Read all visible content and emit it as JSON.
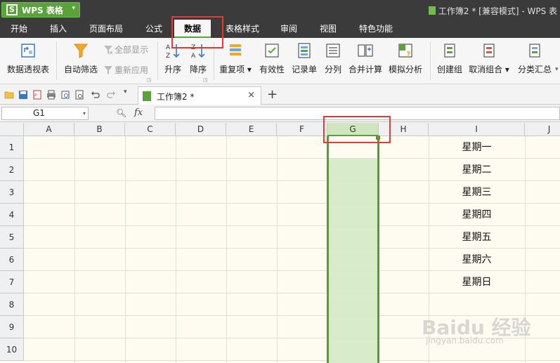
{
  "title_bar": {
    "app_name": "WPS 表格",
    "window_title": "工作簿2 * [兼容模式] - WPS 表"
  },
  "menu": {
    "tabs": [
      "开始",
      "插入",
      "页面布局",
      "公式",
      "数据",
      "表格样式",
      "审阅",
      "视图",
      "特色功能"
    ],
    "active_tab": "数据"
  },
  "ribbon": {
    "pivot_table": "数据透视表",
    "auto_filter": "自动筛选",
    "show_all": "全部显示",
    "reapply": "重新应用",
    "sort_asc": "升序",
    "sort_desc": "降序",
    "duplicates": "重复项",
    "validity": "有效性",
    "record_list": "记录单",
    "split_column": "分列",
    "consolidate": "合并计算",
    "what_if": "模拟分析",
    "group": "创建组",
    "ungroup": "取消组合",
    "subtotal": "分类汇总"
  },
  "document_tab": {
    "label": "工作簿2 *",
    "close": "×",
    "new_tab": "+"
  },
  "formula_bar": {
    "name_box": "G1",
    "fx_label": "fx",
    "formula": ""
  },
  "sheet": {
    "columns": [
      "A",
      "B",
      "C",
      "D",
      "E",
      "F",
      "G",
      "H",
      "I",
      "J"
    ],
    "selected_column": "G",
    "rows": [
      "1",
      "2",
      "3",
      "4",
      "5",
      "6",
      "7",
      "8",
      "9",
      "10"
    ],
    "column_i_values": [
      "星期一",
      "星期二",
      "星期三",
      "星期四",
      "星期五",
      "星期六",
      "星期日"
    ]
  },
  "watermark": {
    "logo": "Baidu 经验",
    "url": "jingyan.baidu.com"
  },
  "colors": {
    "accent": "#5aa33a",
    "title_bar": "#3b3b3b",
    "annotation": "#e53935",
    "grid_bg": "#fefcf0"
  },
  "icons": [
    "save-icon",
    "undo-icon",
    "redo-icon",
    "filter-icon",
    "sort-asc-icon",
    "sort-desc-icon",
    "zoom-icon",
    "fx-icon"
  ]
}
